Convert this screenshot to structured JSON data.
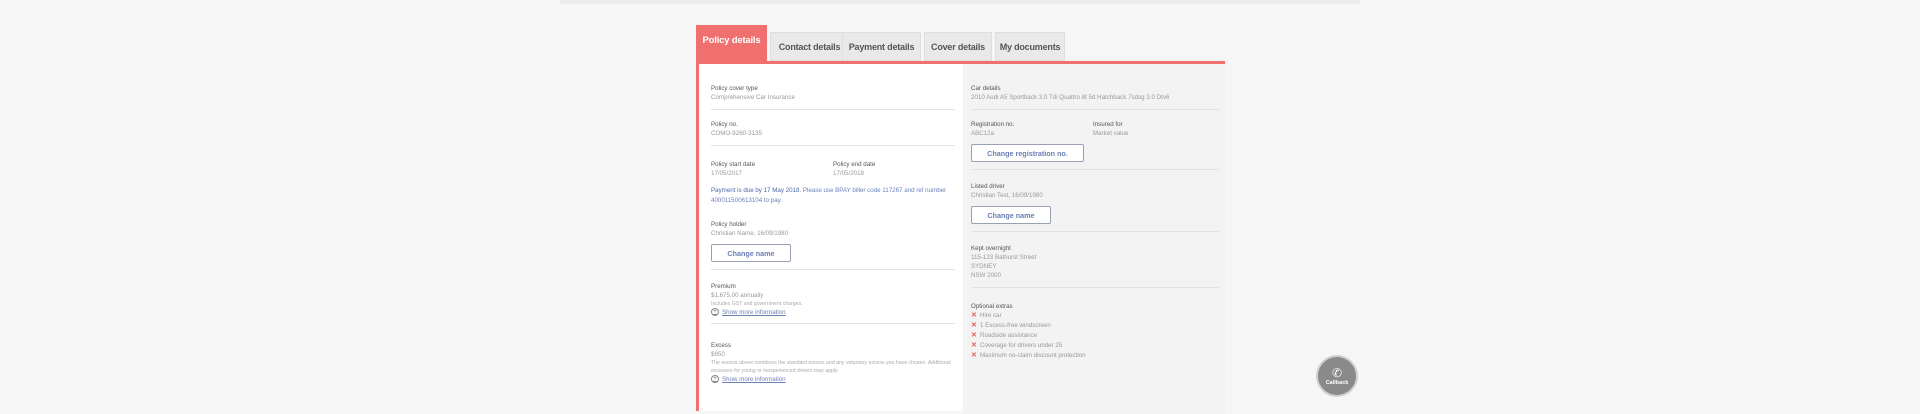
{
  "tabs": [
    {
      "label": "Policy details",
      "active": true
    },
    {
      "label": "Contact details",
      "active": false
    },
    {
      "label": "Payment details",
      "active": false
    },
    {
      "label": "Cover details",
      "active": false
    },
    {
      "label": "My documents",
      "active": false
    }
  ],
  "left": {
    "cover_type": {
      "label": "Policy cover type",
      "value": "Comprehensive Car Insurance"
    },
    "policy_no": {
      "label": "Policy no.",
      "value": "COMO-9260-3135"
    },
    "start_date": {
      "label": "Policy start date",
      "value": "17/05/2017"
    },
    "end_date": {
      "label": "Policy end date",
      "value": "17/05/2018"
    },
    "payment_notice": {
      "emphasis": "Payment is due by 17 May 2018.",
      "text": " Please use BPAY biller code 117267 and ref number 400011500613104 to pay."
    },
    "policy_holder": {
      "label": "Policy holder",
      "value": "Christian Name, 16/09/1980",
      "button": "Change name"
    },
    "premium": {
      "label": "Premium",
      "value": "$1,675.00 annually",
      "note": "Includes GST and government charges.",
      "more": "Show more information"
    },
    "excess": {
      "label": "Excess",
      "value": "$850",
      "note": "The excess above combines the standard excess and any voluntary excess you have chosen. Additional excesses for young or inexperienced drivers may apply.",
      "more": "Show more information"
    }
  },
  "right": {
    "car": {
      "label": "Car details",
      "value": "2010 Audi A5 Sportback 3.0 Tdi Quattro 8t 5d Hatchback 7sdsg 3.0 Dtv6"
    },
    "registration": {
      "label": "Registration no.",
      "value": "ABC12a",
      "button": "Change registration no."
    },
    "insured_for": {
      "label": "Insured for",
      "value": "Market value"
    },
    "listed_driver": {
      "label": "Listed driver",
      "value": "Christian Test, 16/09/1980",
      "button": "Change name"
    },
    "kept_overnight": {
      "label": "Kept overnight",
      "lines": [
        "115-123 Bathurst Street",
        "SYDNEY",
        "NSW 2000"
      ]
    },
    "optional_extras": {
      "label": "Optional extras",
      "items": [
        "Hire car",
        "1 Excess-free windscreen",
        "Roadside assistance",
        "Coverage for drivers under 25",
        "Maximum no-claim discount protection"
      ]
    }
  },
  "callback": {
    "label": "Callback",
    "icon": "phone-icon"
  },
  "colors": {
    "accent": "#ef706e",
    "link": "#6a7fb2",
    "background": "#f6f6f6"
  }
}
